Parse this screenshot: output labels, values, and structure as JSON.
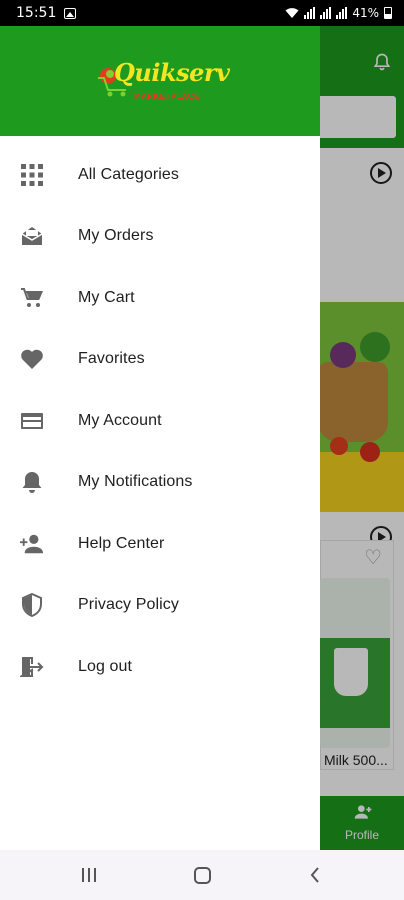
{
  "status_bar": {
    "time": "15:51",
    "battery": "41%"
  },
  "drawer": {
    "logo": {
      "brand": "Quikserv",
      "tagline": "MARKETPLACE"
    },
    "menu": [
      {
        "label": "All Categories",
        "icon": "grid-icon"
      },
      {
        "label": "My Orders",
        "icon": "orders-envelope-icon"
      },
      {
        "label": "My Cart",
        "icon": "cart-icon"
      },
      {
        "label": "Favorites",
        "icon": "heart-icon"
      },
      {
        "label": "My Account",
        "icon": "card-icon"
      },
      {
        "label": "My Notifications",
        "icon": "bell-icon"
      },
      {
        "label": "Help Center",
        "icon": "person-add-icon"
      },
      {
        "label": "Privacy Policy",
        "icon": "shield-icon"
      },
      {
        "label": "Log out",
        "icon": "logout-icon"
      }
    ]
  },
  "background": {
    "product_label": "Milk 500...",
    "bottom_nav": {
      "profile_label": "Profile"
    }
  },
  "colors": {
    "brand_green": "#1e9a1e",
    "logo_yellow": "#f4e521",
    "icon_gray": "#666666"
  }
}
